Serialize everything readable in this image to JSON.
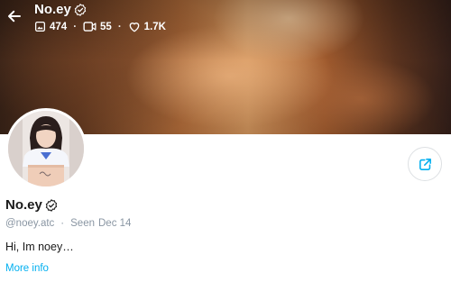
{
  "header": {
    "name": "No.ey",
    "stats": {
      "photos": "474",
      "videos": "55",
      "likes": "1.7K"
    }
  },
  "profile": {
    "name": "No.ey",
    "username": "@noey.atc",
    "seen_label": "Seen",
    "seen_date": "Dec 14",
    "bio": "Hi, Im noey…",
    "more_info": "More info"
  },
  "colors": {
    "accent": "#00aff0",
    "meta_text": "#8a96a3",
    "text": "#1a1a1a"
  },
  "icons": {
    "back": "arrow-left-icon",
    "verified": "verified-badge-icon",
    "photos": "image-icon",
    "videos": "video-icon",
    "likes": "heart-icon",
    "share": "share-icon"
  }
}
